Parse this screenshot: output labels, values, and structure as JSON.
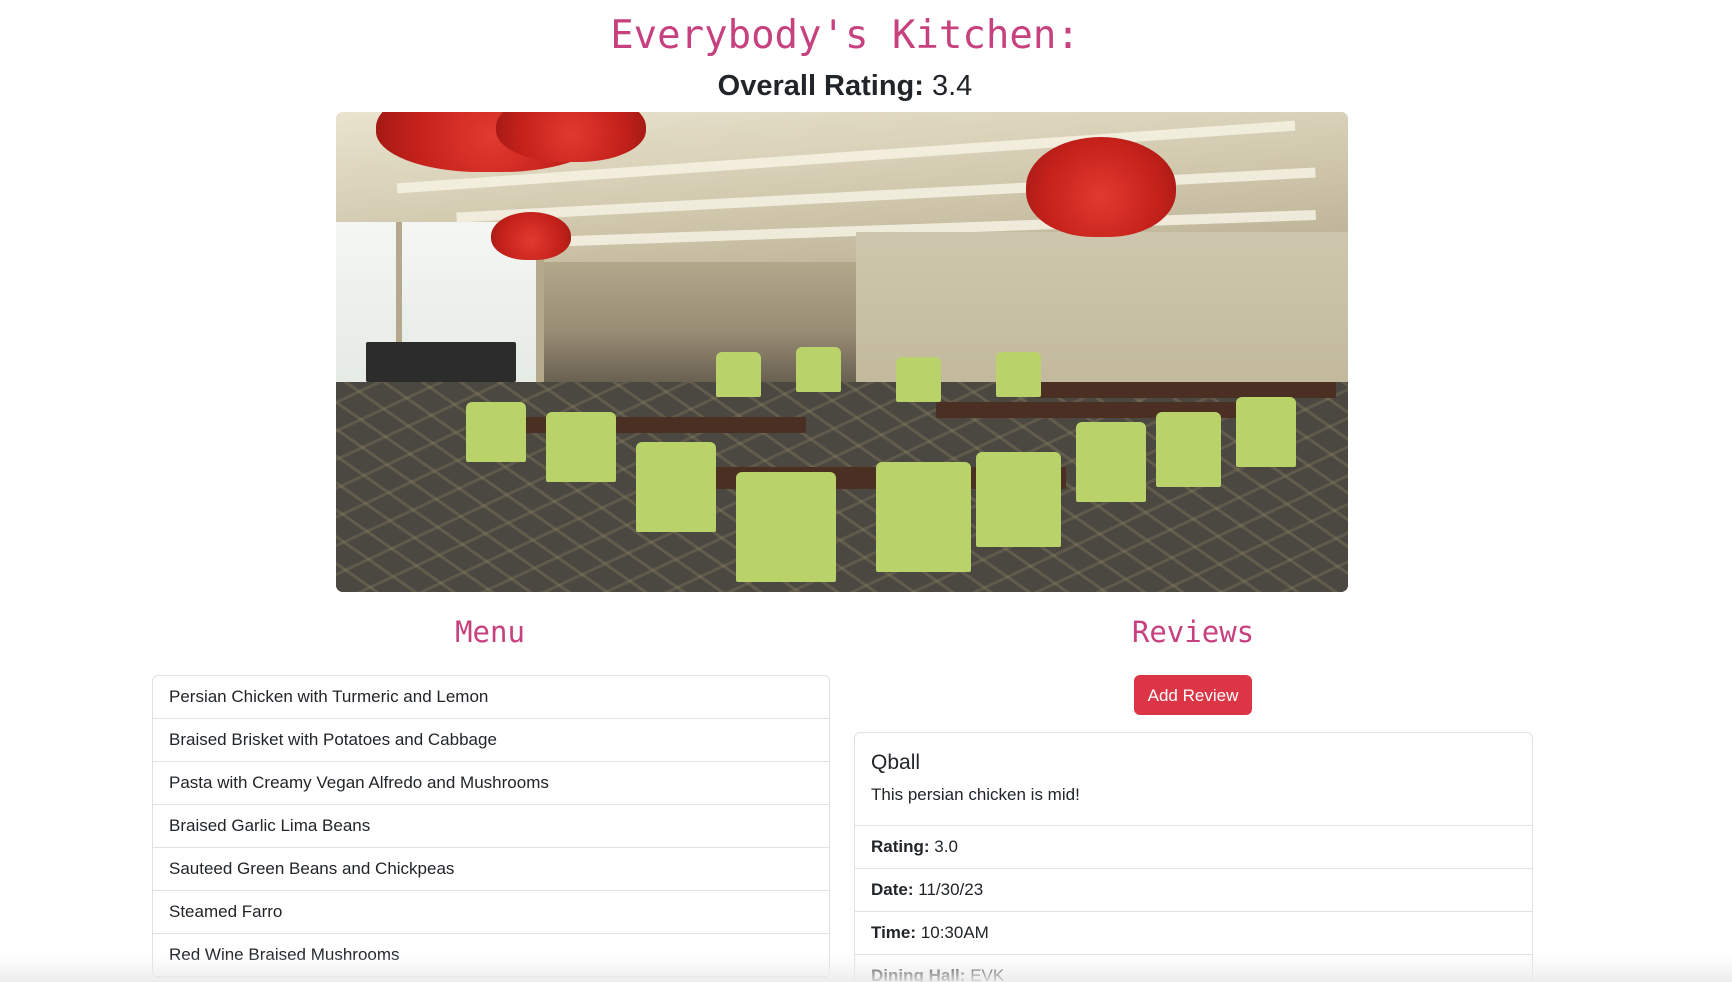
{
  "header": {
    "title": "Everybody's Kitchen:",
    "rating_label": "Overall Rating:",
    "rating_value": "3.4"
  },
  "hero": {
    "description": "dining hall interior"
  },
  "menu": {
    "title": "Menu",
    "items": [
      "Persian Chicken with Turmeric and Lemon",
      "Braised Brisket with Potatoes and Cabbage",
      "Pasta with Creamy Vegan Alfredo and Mushrooms",
      "Braised Garlic Lima Beans",
      "Sauteed Green Beans and Chickpeas",
      "Steamed Farro",
      "Red Wine Braised Mushrooms"
    ]
  },
  "reviews": {
    "title": "Reviews",
    "add_label": "Add Review",
    "items": [
      {
        "author": "Qball",
        "text": "This persian chicken is mid!",
        "rating_label": "Rating:",
        "rating": "3.0",
        "date_label": "Date:",
        "date": "11/30/23",
        "time_label": "Time:",
        "time": "10:30AM",
        "hall_label": "Dining Hall:",
        "hall": "EVK"
      }
    ]
  },
  "colors": {
    "accent": "#c7417f",
    "button": "#dc3545",
    "border": "#dee2e6"
  }
}
